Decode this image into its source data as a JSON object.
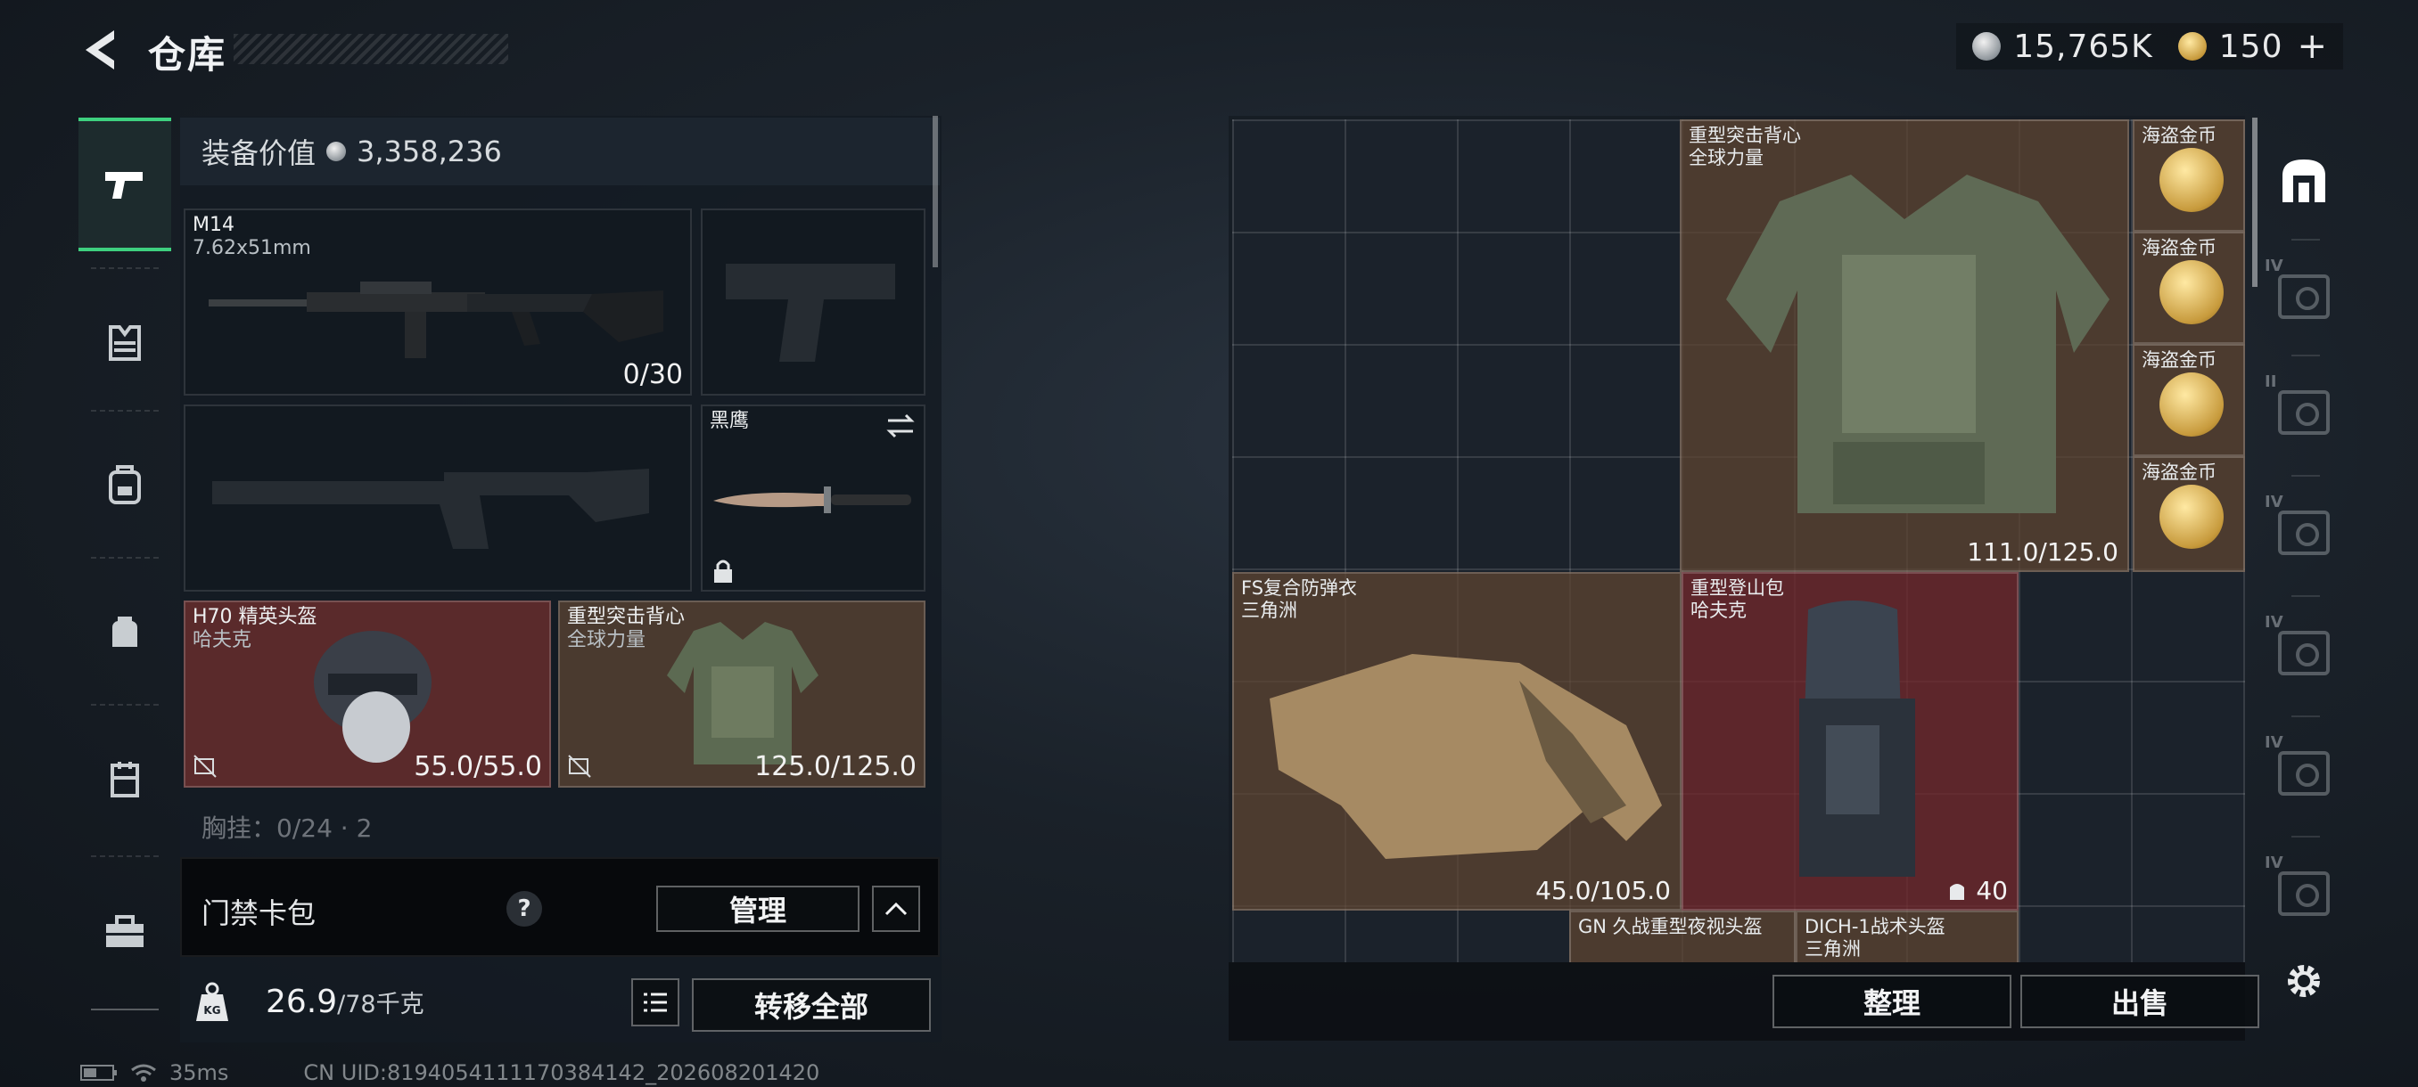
{
  "header": {
    "title": "仓库"
  },
  "currency": {
    "silver": "15,765K",
    "gold": "150",
    "plus": "+"
  },
  "left_nav": {
    "items": [
      "pistol-icon",
      "armor-rig-icon",
      "backpack-icon",
      "bag-icon",
      "chest-rig-icon",
      "toolbox-icon"
    ]
  },
  "equipment": {
    "value_label": "装备价值",
    "value": "3,358,236",
    "primary": {
      "name": "M14",
      "caliber": "7.62x51mm",
      "ammo": "0/30"
    },
    "melee": {
      "name": "黑鹰"
    },
    "helmet": {
      "name": "H70 精英头盔",
      "brand": "哈夫克",
      "durability": "55.0/55.0"
    },
    "armor": {
      "name": "重型突击背心",
      "brand": "全球力量",
      "durability": "125.0/125.0"
    },
    "chest_rig": "胸挂：0/24 · 2",
    "keycard": {
      "label": "门禁卡包",
      "help": "?",
      "manage": "管理"
    },
    "weight": {
      "current": "26.9",
      "max": "/78千克"
    },
    "transfer_all": "转移全部"
  },
  "storage": {
    "items": [
      {
        "name": "重型突击背心",
        "brand": "全球力量",
        "value": "111.0/125.0",
        "color": "brown"
      },
      {
        "name": "海盗金币",
        "color": "brown"
      },
      {
        "name": "海盗金币",
        "color": "brown"
      },
      {
        "name": "海盗金币",
        "color": "brown"
      },
      {
        "name": "海盗金币",
        "color": "brown"
      },
      {
        "name": "FS复合防弹衣",
        "brand": "三角洲",
        "value": "45.0/105.0",
        "color": "brown"
      },
      {
        "name": "重型登山包",
        "brand": "哈夫克",
        "value": "40",
        "color": "red"
      },
      {
        "name": "GN 久战重型夜视头盔",
        "color": "brown"
      },
      {
        "name": "DICH-1战术头盔",
        "brand": "三角洲",
        "color": "brown"
      }
    ],
    "sort_button": "整理",
    "sell_button": "出售"
  },
  "right_nav": {
    "levels": [
      "IV",
      "II",
      "IV",
      "IV",
      "IV",
      "IV"
    ]
  },
  "status": {
    "ping": "35ms",
    "uid": "CN UID:8194054111170384142_202608201420"
  },
  "colors": {
    "accent_green": "#3ed07f",
    "rarity_red": "#5a2a2b",
    "rarity_brown": "#4a3a2f"
  }
}
